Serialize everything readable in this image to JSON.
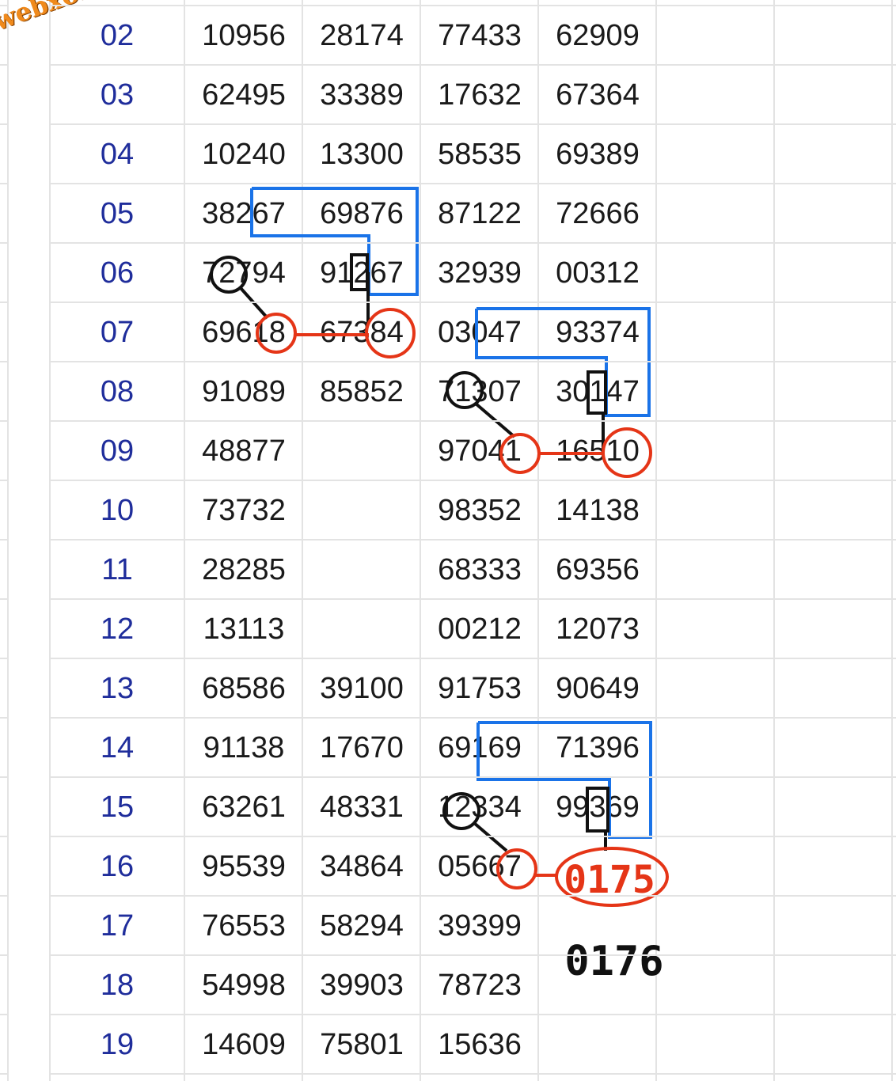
{
  "watermark": "webxoso.net",
  "rows": [
    {
      "day": "02",
      "c1": "10956",
      "c2": "28174",
      "c3": "77433",
      "c4": "62909"
    },
    {
      "day": "03",
      "c1": "62495",
      "c2": "33389",
      "c3": "17632",
      "c4": "67364"
    },
    {
      "day": "04",
      "c1": "10240",
      "c2": "13300",
      "c3": "58535",
      "c4": "69389"
    },
    {
      "day": "05",
      "c1": "38267",
      "c2": "69876",
      "c3": "87122",
      "c4": "72666"
    },
    {
      "day": "06",
      "c1": "72794",
      "c2": "91267",
      "c3": "32939",
      "c4": "00312"
    },
    {
      "day": "07",
      "c1": "69618",
      "c2": "67384",
      "c3": "03047",
      "c4": "93374"
    },
    {
      "day": "08",
      "c1": "91089",
      "c2": "85852",
      "c3": "71307",
      "c4": "30147"
    },
    {
      "day": "09",
      "c1": "48877",
      "c2": "",
      "c3": "97041",
      "c4": "16510"
    },
    {
      "day": "10",
      "c1": "73732",
      "c2": "",
      "c3": "98352",
      "c4": "14138"
    },
    {
      "day": "11",
      "c1": "28285",
      "c2": "",
      "c3": "68333",
      "c4": "69356"
    },
    {
      "day": "12",
      "c1": "13113",
      "c2": "",
      "c3": "00212",
      "c4": "12073"
    },
    {
      "day": "13",
      "c1": "68586",
      "c2": "39100",
      "c3": "91753",
      "c4": "90649"
    },
    {
      "day": "14",
      "c1": "91138",
      "c2": "17670",
      "c3": "69169",
      "c4": "71396"
    },
    {
      "day": "15",
      "c1": "63261",
      "c2": "48331",
      "c3": "12334",
      "c4": "99369"
    },
    {
      "day": "16",
      "c1": "95539",
      "c2": "34864",
      "c3": "05667",
      "c4": ""
    },
    {
      "day": "17",
      "c1": "76553",
      "c2": "58294",
      "c3": "39399",
      "c4": ""
    },
    {
      "day": "18",
      "c1": "54998",
      "c2": "39903",
      "c3": "78723",
      "c4": ""
    },
    {
      "day": "19",
      "c1": "14609",
      "c2": "75801",
      "c3": "15636",
      "c4": ""
    }
  ],
  "annotations": {
    "prediction": "0175",
    "prediction_alt": "0176"
  },
  "colors": {
    "day_text": "#1f2d9b",
    "blue_marker": "#1a73e8",
    "red_marker": "#e53517",
    "black_marker": "#111111",
    "watermark": "#f08a1c"
  }
}
